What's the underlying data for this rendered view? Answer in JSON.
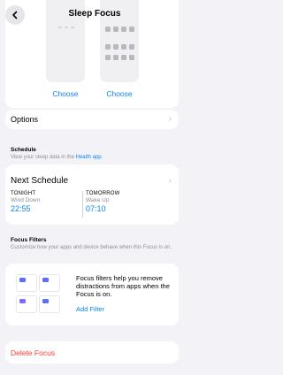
{
  "nav": {
    "title": "Sleep Focus"
  },
  "preview": {
    "choose_left": "Choose",
    "choose_right": "Choose"
  },
  "options": {
    "label": "Options"
  },
  "schedule_section": {
    "heading": "Schedule",
    "subtitle_prefix": "View your sleep data in the ",
    "subtitle_link": "Health app",
    "subtitle_suffix": "."
  },
  "schedule": {
    "title": "Next Schedule",
    "slots": [
      {
        "label": "TONIGHT",
        "sub": "Wind Down",
        "time": "22:55"
      },
      {
        "label": "TOMORROW",
        "sub": "Wake Up",
        "time": "07:10"
      }
    ]
  },
  "filters_section": {
    "heading": "Focus Filters",
    "subtitle": "Customize how your apps and device behave when this Focus is on."
  },
  "filters": {
    "description": "Focus filters help you remove distractions from apps when the Focus is on.",
    "add_label": "Add Filter"
  },
  "delete": {
    "label": "Delete Focus"
  },
  "colors": {
    "accent": "#0a84ff",
    "destructive": "#ff3b30"
  }
}
